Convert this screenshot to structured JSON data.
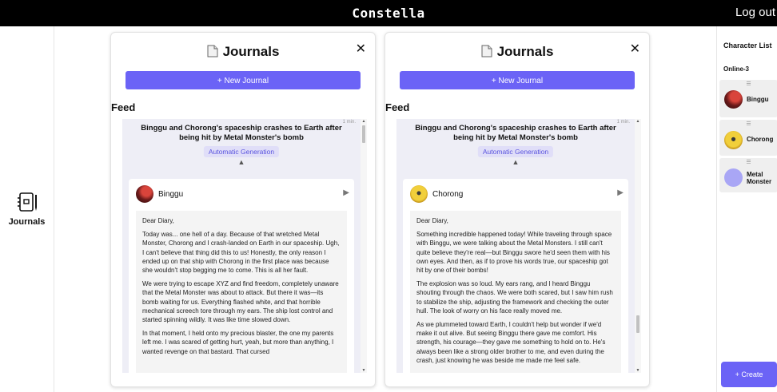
{
  "app": {
    "title": "Constella",
    "logout_label": "Log out"
  },
  "left_nav": {
    "items": [
      {
        "label": "Journals",
        "icon": "journal-icon"
      }
    ]
  },
  "panels": [
    {
      "title": "Journals",
      "close_label": "✕",
      "new_button_label": "+ New Journal",
      "feed_label": "Feed",
      "event": {
        "time": "1 min.",
        "title": "Binggu and Chorong's spaceship crashes to Earth after being hit by Metal Monster's bomb",
        "badge": "Automatic Generation",
        "collapse_arrow": "▲"
      },
      "entry": {
        "author": "Binggu",
        "play_label": "▶",
        "paragraphs": [
          "Dear Diary,",
          "Today was... one hell of a day. Because of that wretched Metal Monster, Chorong and I crash-landed on Earth in our spaceship. Ugh, I can't believe that thing did this to us! Honestly, the only reason I ended up on that ship with Chorong in the first place was because she wouldn't stop begging me to come. This is all her fault.",
          "We were trying to escape XYZ and find freedom, completely unaware that the Metal Monster was about to attack. But there it was—its bomb waiting for us. Everything flashed white, and that horrible mechanical screech tore through my ears. The ship lost control and started spinning wildly. It was like time slowed down.",
          "In that moment, I held onto my precious blaster, the one my parents left me. I was scared of getting hurt, yeah, but more than anything, I wanted revenge on that bastard. That cursed"
        ]
      },
      "scroll": {
        "position": 0.0
      }
    },
    {
      "title": "Journals",
      "close_label": "✕",
      "new_button_label": "+ New Journal",
      "feed_label": "Feed",
      "event": {
        "time": "1 min.",
        "title": "Binggu and Chorong's spaceship crashes to Earth after being hit by Metal Monster's bomb",
        "badge": "Automatic Generation",
        "collapse_arrow": "▲"
      },
      "entry": {
        "author": "Chorong",
        "play_label": "▶",
        "paragraphs": [
          "Dear Diary,",
          "Something incredible happened today! While traveling through space with Binggu, we were talking about the Metal Monsters. I still can't quite believe they're real—but Binggu swore he'd seen them with his own eyes. And then, as if to prove his words true, our spaceship got hit by one of their bombs!",
          "The explosion was so loud. My ears rang, and I heard Binggu shouting through the chaos. We were both scared, but I saw him rush to stabilize the ship, adjusting the framework and checking the outer hull. The look of worry on his face really moved me.",
          "As we plummeted toward Earth, I couldn't help but wonder if we'd make it out alive. But seeing Binggu there gave me comfort. His strength, his courage—they gave me something to hold on to. He's always been like a strong older brother to me, and even during the crash, just knowing he was beside me made me feel safe."
        ]
      },
      "scroll": {
        "position": 0.85
      }
    }
  ],
  "character_list": {
    "title": "Character List",
    "online_label": "Online-3",
    "drag_glyph": "☰",
    "characters": [
      {
        "name": "Binggu",
        "avatar_color": "#7a1f1f"
      },
      {
        "name": "Chorong",
        "avatar_color": "#e9c23a"
      },
      {
        "name": "Metal Monster",
        "avatar_color": "#a9a6f5"
      }
    ],
    "create_label": "+ Create"
  },
  "colors": {
    "accent": "#6b63f6",
    "badge_bg": "#e0def8",
    "event_bg": "#eeeef6"
  }
}
